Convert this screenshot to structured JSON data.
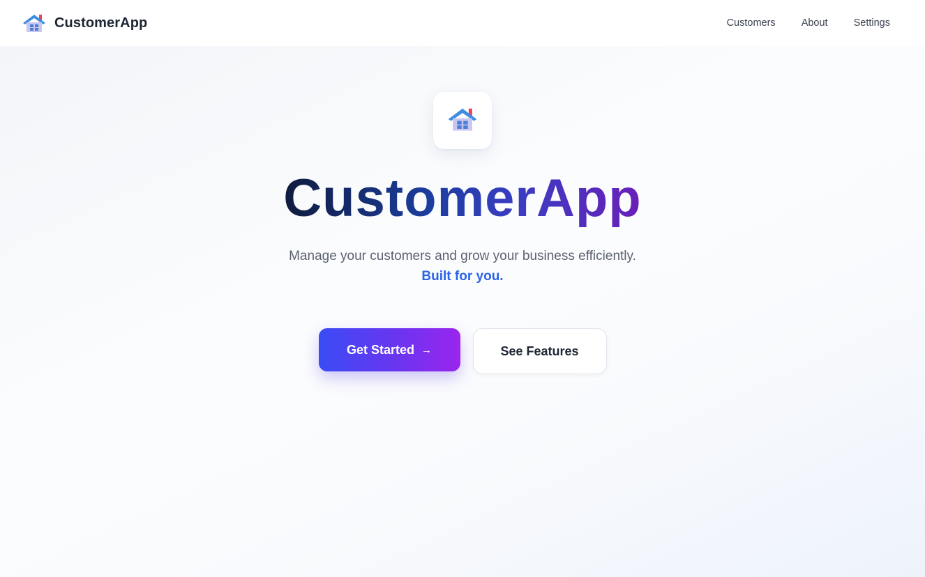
{
  "navbar": {
    "brand_icon": "house-icon",
    "brand_name": "CustomerApp",
    "links": [
      {
        "label": "Customers"
      },
      {
        "label": "About"
      },
      {
        "label": "Settings"
      }
    ]
  },
  "hero": {
    "logo_icon": "house-icon",
    "title": "CustomerApp",
    "subtitle": "Manage your customers and grow your business efficiently.",
    "highlight": "Built for you.",
    "primary_button": {
      "label": "Get Started",
      "arrow": "→",
      "icon": "arrow-right-icon"
    },
    "secondary_button": {
      "label": "See Features"
    }
  },
  "colors": {
    "accent_blue": "#2b63e8",
    "gradient_start": "#3a4cf5",
    "gradient_end": "#9a25ee",
    "title_dark": "#0f1b3d",
    "title_purple": "#6a1fb8"
  }
}
